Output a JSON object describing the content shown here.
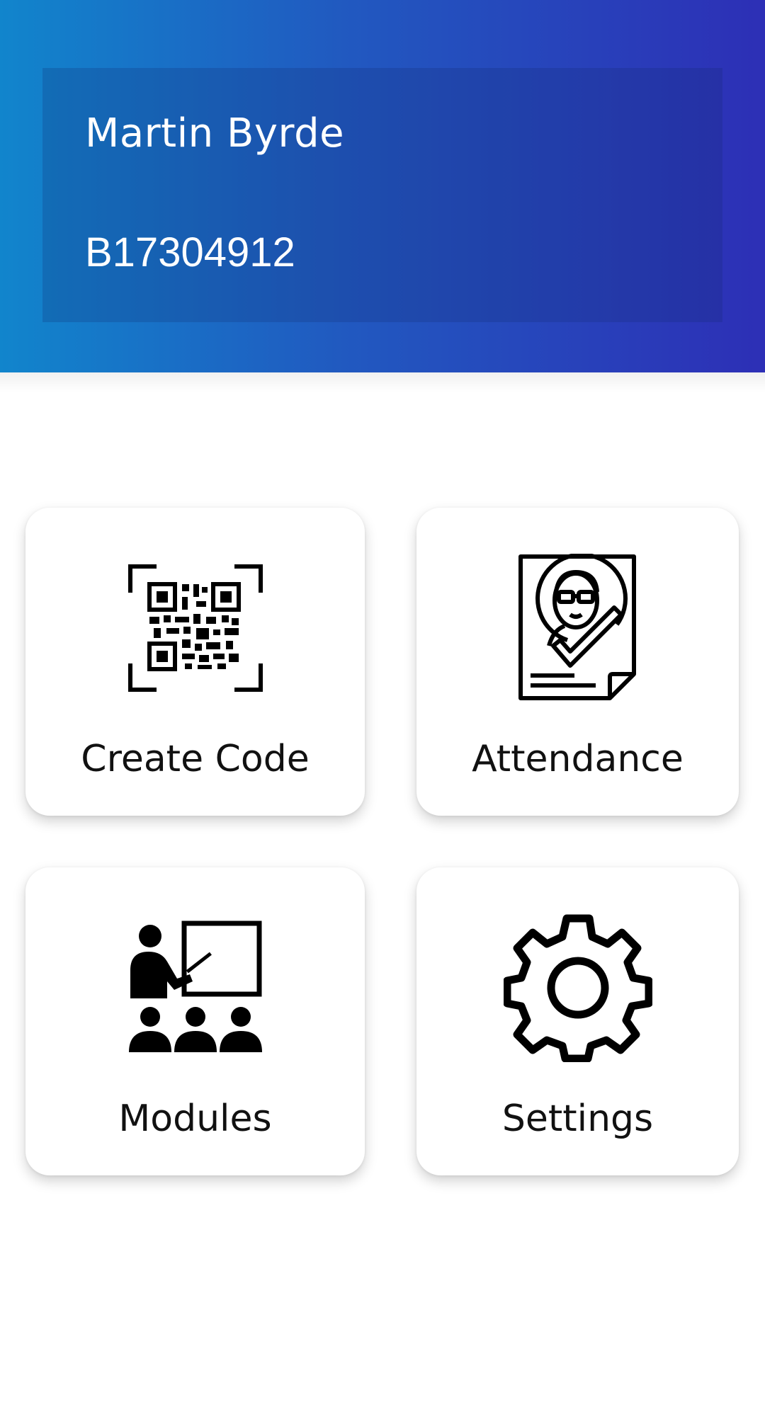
{
  "profile": {
    "name": "Martin Byrde",
    "id": "B17304912"
  },
  "tiles": [
    {
      "label": "Create Code",
      "icon": "qr-code-icon"
    },
    {
      "label": "Attendance",
      "icon": "attendance-document-icon"
    },
    {
      "label": "Modules",
      "icon": "teacher-presentation-icon"
    },
    {
      "label": "Settings",
      "icon": "gear-icon"
    }
  ],
  "colors": {
    "header_gradient_start": "#1185cc",
    "header_gradient_end": "#2d2fb6",
    "text_primary": "#111111"
  }
}
